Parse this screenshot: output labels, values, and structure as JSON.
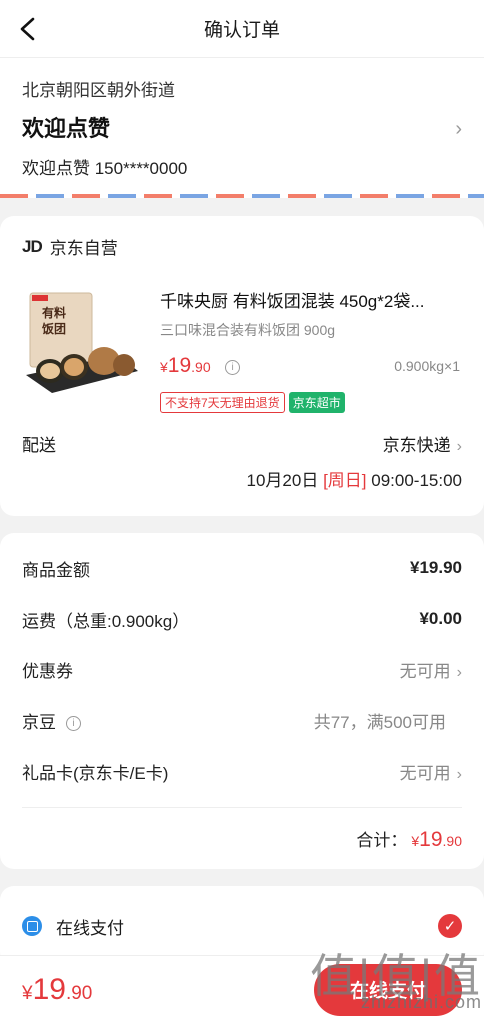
{
  "header": {
    "title": "确认订单"
  },
  "address": {
    "region": "北京朝阳区朝外街道",
    "name": "欢迎点赞",
    "contact": "欢迎点赞 150****0000"
  },
  "shop": {
    "logo": "JD",
    "name": "京东自营"
  },
  "product": {
    "name": "千味央厨 有料饭团混装 450g*2袋...",
    "spec": "三口味混合装有料饭团 900g",
    "price_cur": "¥",
    "price_int": "19",
    "price_dec": ".90",
    "qty": "0.900kg×1",
    "tag_noreturn": "不支持7天无理由退货",
    "tag_supermarket": "京东超市",
    "image_text": "有料饭团"
  },
  "shipping": {
    "label": "配送",
    "carrier": "京东快递",
    "date": "10月20日",
    "weekday": "[周日]",
    "time": "09:00-15:00"
  },
  "amounts": {
    "goods_label": "商品金额",
    "goods_value": "¥19.90",
    "freight_label": "运费（总重:0.900kg）",
    "freight_value": "¥0.00",
    "coupon_label": "优惠券",
    "coupon_value": "无可用",
    "beans_label": "京豆",
    "beans_value": "共77，满500可用",
    "giftcard_label": "礼品卡(京东卡/E卡)",
    "giftcard_value": "无可用",
    "total_label": "合计：",
    "total_cur": "¥",
    "total_int": "19",
    "total_dec": ".90"
  },
  "payment": {
    "method": "在线支付"
  },
  "bottom": {
    "cur": "¥",
    "int": "19",
    "dec": ".90",
    "submit_label": "在线支付"
  },
  "watermark": {
    "main": "值|值|值",
    "sub": "zhizhizhi.com"
  },
  "colors": {
    "accent": "#e4393c",
    "green": "#20b36b",
    "blue": "#2c8ee8"
  }
}
